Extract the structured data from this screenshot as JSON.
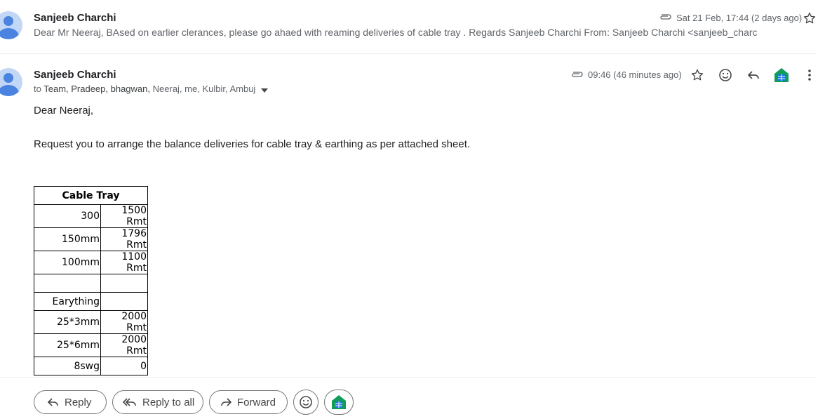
{
  "collapsed_message": {
    "sender": "Sanjeeb Charchi",
    "snippet": "Dear Mr Neeraj, BAsed on earlier clerances, please go ahaed with reaming deliveries of cable tray . Regards Sanjeeb Charchi From: Sanjeeb Charchi <sanjeeb_charc",
    "date": "Sat 21 Feb, 17:44 (2 days ago)"
  },
  "open_message": {
    "sender": "Sanjeeb Charchi",
    "to_prefix": "to",
    "recipients_dark": "Team, Pradeep, bhagwan,",
    "recipients_light": "Neeraj, me, Kulbir, Ambuj",
    "time": "09:46 (46 minutes ago)",
    "greeting": "Dear Neeraj,",
    "body": "Request you to arrange the balance deliveries for cable tray & earthing as per attached sheet.",
    "table": {
      "header": "Cable Tray",
      "rows": [
        [
          "300",
          "1500 Rmt"
        ],
        [
          "150mm",
          "1796 Rmt"
        ],
        [
          "100mm",
          "1100 Rmt"
        ],
        [
          "",
          ""
        ],
        [
          "Earything",
          ""
        ],
        [
          "25*3mm",
          "2000 Rmt"
        ],
        [
          "25*6mm",
          "2000 Rmt"
        ],
        [
          "8swg",
          "0"
        ]
      ]
    }
  },
  "actions": {
    "reply": "Reply",
    "reply_all": "Reply to all",
    "forward": "Forward"
  },
  "icons": {
    "attachment": "paperclip-icon",
    "star": "star-icon",
    "emoji": "emoji-icon",
    "reply": "reply-icon",
    "sheets_addon": "sheets-icon",
    "more": "more-vert-icon"
  },
  "colors": {
    "avatar_bg": "#c2d7f5",
    "avatar_fg": "#4a84e0",
    "sheets_green": "#0f9d58",
    "sheets_blue": "#1a73e8"
  }
}
